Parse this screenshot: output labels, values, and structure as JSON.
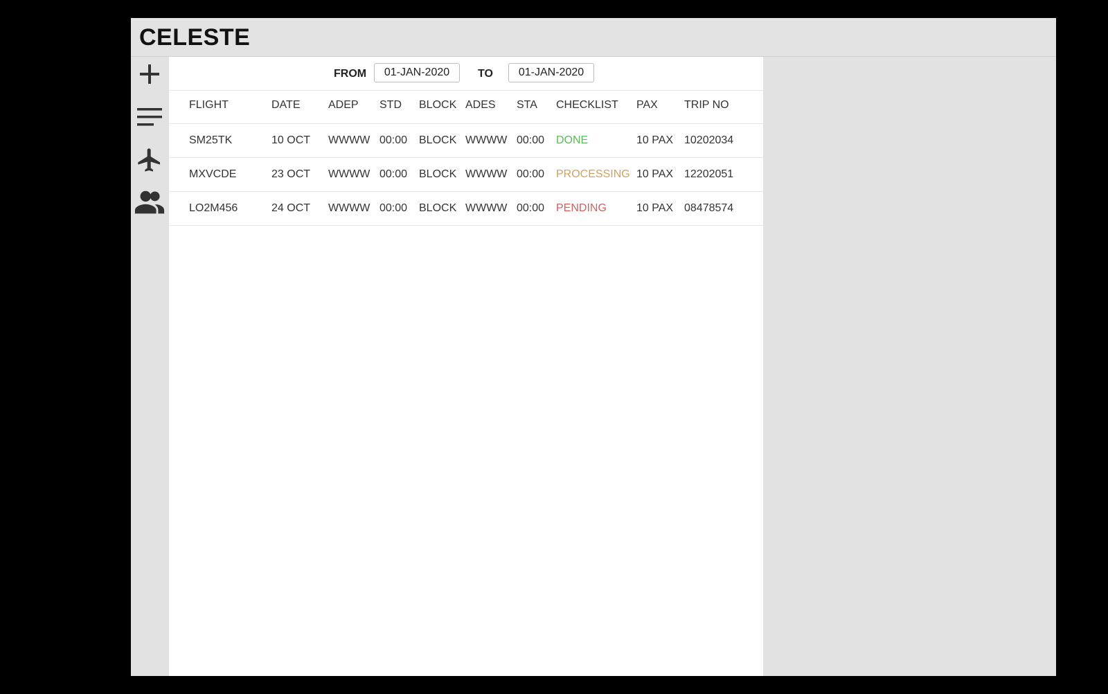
{
  "app": {
    "title": "CELESTE"
  },
  "sidebar": {
    "items": [
      {
        "name": "add",
        "icon": "plus-icon"
      },
      {
        "name": "list",
        "icon": "menu-lines-icon"
      },
      {
        "name": "flights",
        "icon": "airplane-icon"
      },
      {
        "name": "people",
        "icon": "people-icon"
      }
    ]
  },
  "filter": {
    "from_label": "FROM",
    "from_value": "01-JAN-2020",
    "to_label": "TO",
    "to_value": "01-JAN-2020"
  },
  "table": {
    "columns": [
      "FLIGHT",
      "DATE",
      "ADEP",
      "STD",
      "BLOCK",
      "ADES",
      "STA",
      "CHECKLIST",
      "PAX",
      "TRIP NO"
    ],
    "rows": [
      {
        "flight": "SM25TK",
        "date": "10 OCT",
        "adep": "WWWW",
        "std": "00:00",
        "block": "BLOCK",
        "ades": "WWWW",
        "sta": "00:00",
        "checklist": "DONE",
        "pax": "10 PAX",
        "trip_no": "10202034"
      },
      {
        "flight": "MXVCDE",
        "date": "23 OCT",
        "adep": "WWWW",
        "std": "00:00",
        "block": "BLOCK",
        "ades": "WWWW",
        "sta": "00:00",
        "checklist": "PROCESSING",
        "pax": "10 PAX",
        "trip_no": "12202051"
      },
      {
        "flight": "LO2M456",
        "date": "24 OCT",
        "adep": "WWWW",
        "std": "00:00",
        "block": "BLOCK",
        "ades": "WWWW",
        "sta": "00:00",
        "checklist": "PENDING",
        "pax": "10 PAX",
        "trip_no": "08478574"
      }
    ]
  },
  "status_colors": {
    "done": "#5cb85c",
    "processing": "#d4a05a",
    "pending": "#d35f5f"
  }
}
